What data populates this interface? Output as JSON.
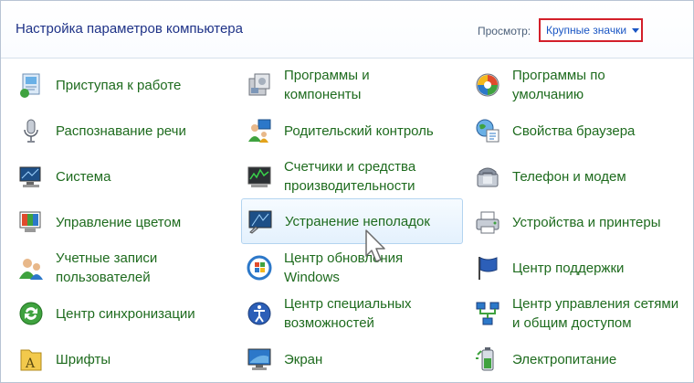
{
  "header": {
    "title": "Настройка параметров компьютера",
    "view_label": "Просмотр:",
    "view_value": "Крупные значки"
  },
  "items": [
    {
      "label": "Приступая к работе",
      "icon": "getting-started-icon"
    },
    {
      "label": "Программы и\nкомпоненты",
      "icon": "programs-features-icon"
    },
    {
      "label": "Программы по\nумолчанию",
      "icon": "default-programs-icon"
    },
    {
      "label": "Распознавание речи",
      "icon": "microphone-icon"
    },
    {
      "label": "Родительский контроль",
      "icon": "parental-controls-icon"
    },
    {
      "label": "Свойства браузера",
      "icon": "globe-icon"
    },
    {
      "label": "Система",
      "icon": "computer-icon"
    },
    {
      "label": "Счетчики и средства\nпроизводительности",
      "icon": "performance-icon"
    },
    {
      "label": "Телефон и модем",
      "icon": "phone-icon"
    },
    {
      "label": "Управление цветом",
      "icon": "color-management-icon"
    },
    {
      "label": "Устранение неполадок",
      "icon": "troubleshooting-icon"
    },
    {
      "label": "Устройства и принтеры",
      "icon": "printer-icon"
    },
    {
      "label": "Учетные записи\nпользователей",
      "icon": "user-accounts-icon"
    },
    {
      "label": "Центр обновления\nWindows",
      "icon": "windows-update-icon"
    },
    {
      "label": "Центр поддержки",
      "icon": "flag-icon"
    },
    {
      "label": "Центр синхронизации",
      "icon": "sync-icon"
    },
    {
      "label": "Центр специальных\nвозможностей",
      "icon": "accessibility-icon"
    },
    {
      "label": "Центр управления сетями\nи общим доступом",
      "icon": "network-icon"
    },
    {
      "label": "Шрифты",
      "icon": "fonts-icon"
    },
    {
      "label": "Экран",
      "icon": "display-icon"
    },
    {
      "label": "Электропитание",
      "icon": "power-icon"
    }
  ]
}
